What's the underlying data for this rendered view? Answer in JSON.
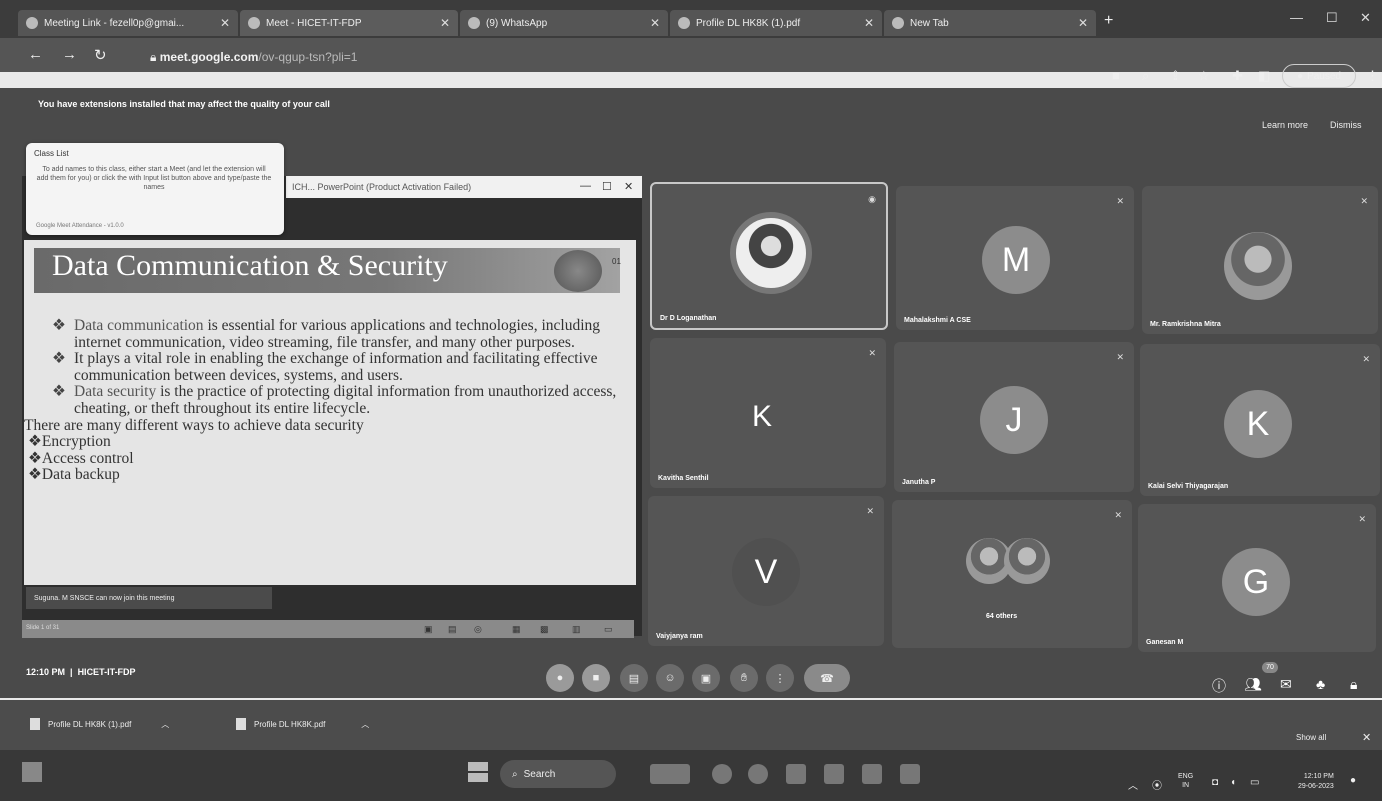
{
  "browser": {
    "tabs": [
      {
        "label": "Meeting Link - fezell0p@gmai..."
      },
      {
        "label": "Meet - HICET-IT-FDP"
      },
      {
        "label": "(9) WhatsApp"
      },
      {
        "label": "Profile DL HK8K (1).pdf"
      },
      {
        "label": "New Tab"
      }
    ],
    "url_host": "meet.google.com",
    "url_path": "/ov-qgup-tsn?pli=1",
    "paused_label": "Paused"
  },
  "meet": {
    "extension_notice": "You have extensions installed that may affect the quality of your call",
    "learn_more": "Learn more",
    "dismiss": "Dismiss",
    "class_list": {
      "header": "Class List",
      "body": "To add names to this class, either start a Meet (and let the extension will add them for you) or click the with Input list button above and type/paste the names",
      "footer": "Google Meet Attendance - v1.0.0"
    },
    "ppt_title": "ICH... PowerPoint (Product Activation Failed)",
    "slide": {
      "title": "Data Communication & Security",
      "number": "01",
      "p1_highlight": "Data communication",
      "p1_rest": " is essential for various applications and technologies, including internet communication, video streaming, file transfer, and many other purposes.",
      "p2": "It plays a vital role in enabling the exchange of information and facilitating effective communication between devices, systems, and users.",
      "p3_highlight": "Data security",
      "p3_rest": " is the practice of protecting digital information from unauthorized access, cheating, or theft throughout its entire lifecycle.",
      "p4": "There are many different ways to achieve data security",
      "items": [
        "Encryption",
        "Access control",
        "Data backup"
      ]
    },
    "join_notice": "Suguna. M SNSCE can now join this meeting",
    "slide_count": "Slide 1 of 31",
    "participants": [
      {
        "name": "Dr D Loganathan",
        "initial": ""
      },
      {
        "name": "Mahalakshmi A CSE",
        "initial": "M"
      },
      {
        "name": "Mr. Ramkrishna Mitra",
        "initial": ""
      },
      {
        "name": "Kavitha Senthil",
        "initial": "K"
      },
      {
        "name": "Janutha P",
        "initial": "J"
      },
      {
        "name": "Kalai Selvi Thiyagarajan",
        "initial": "K"
      },
      {
        "name": "Vaiyjanya ram",
        "initial": "V"
      },
      {
        "name": "64 others",
        "initial": ""
      },
      {
        "name": "Ganesan M",
        "initial": "G"
      }
    ],
    "time": "12:10 PM",
    "meeting_code": "HICET-IT-FDP",
    "participant_badge": "70"
  },
  "downloads": [
    {
      "name": "Profile DL HK8K (1).pdf"
    },
    {
      "name": "Profile DL HK8K.pdf"
    }
  ],
  "show_all": "Show all",
  "taskbar": {
    "search": "Search",
    "lang_top": "ENG",
    "lang_bottom": "IN",
    "time": "12:10 PM",
    "date": "29-06-2023"
  }
}
